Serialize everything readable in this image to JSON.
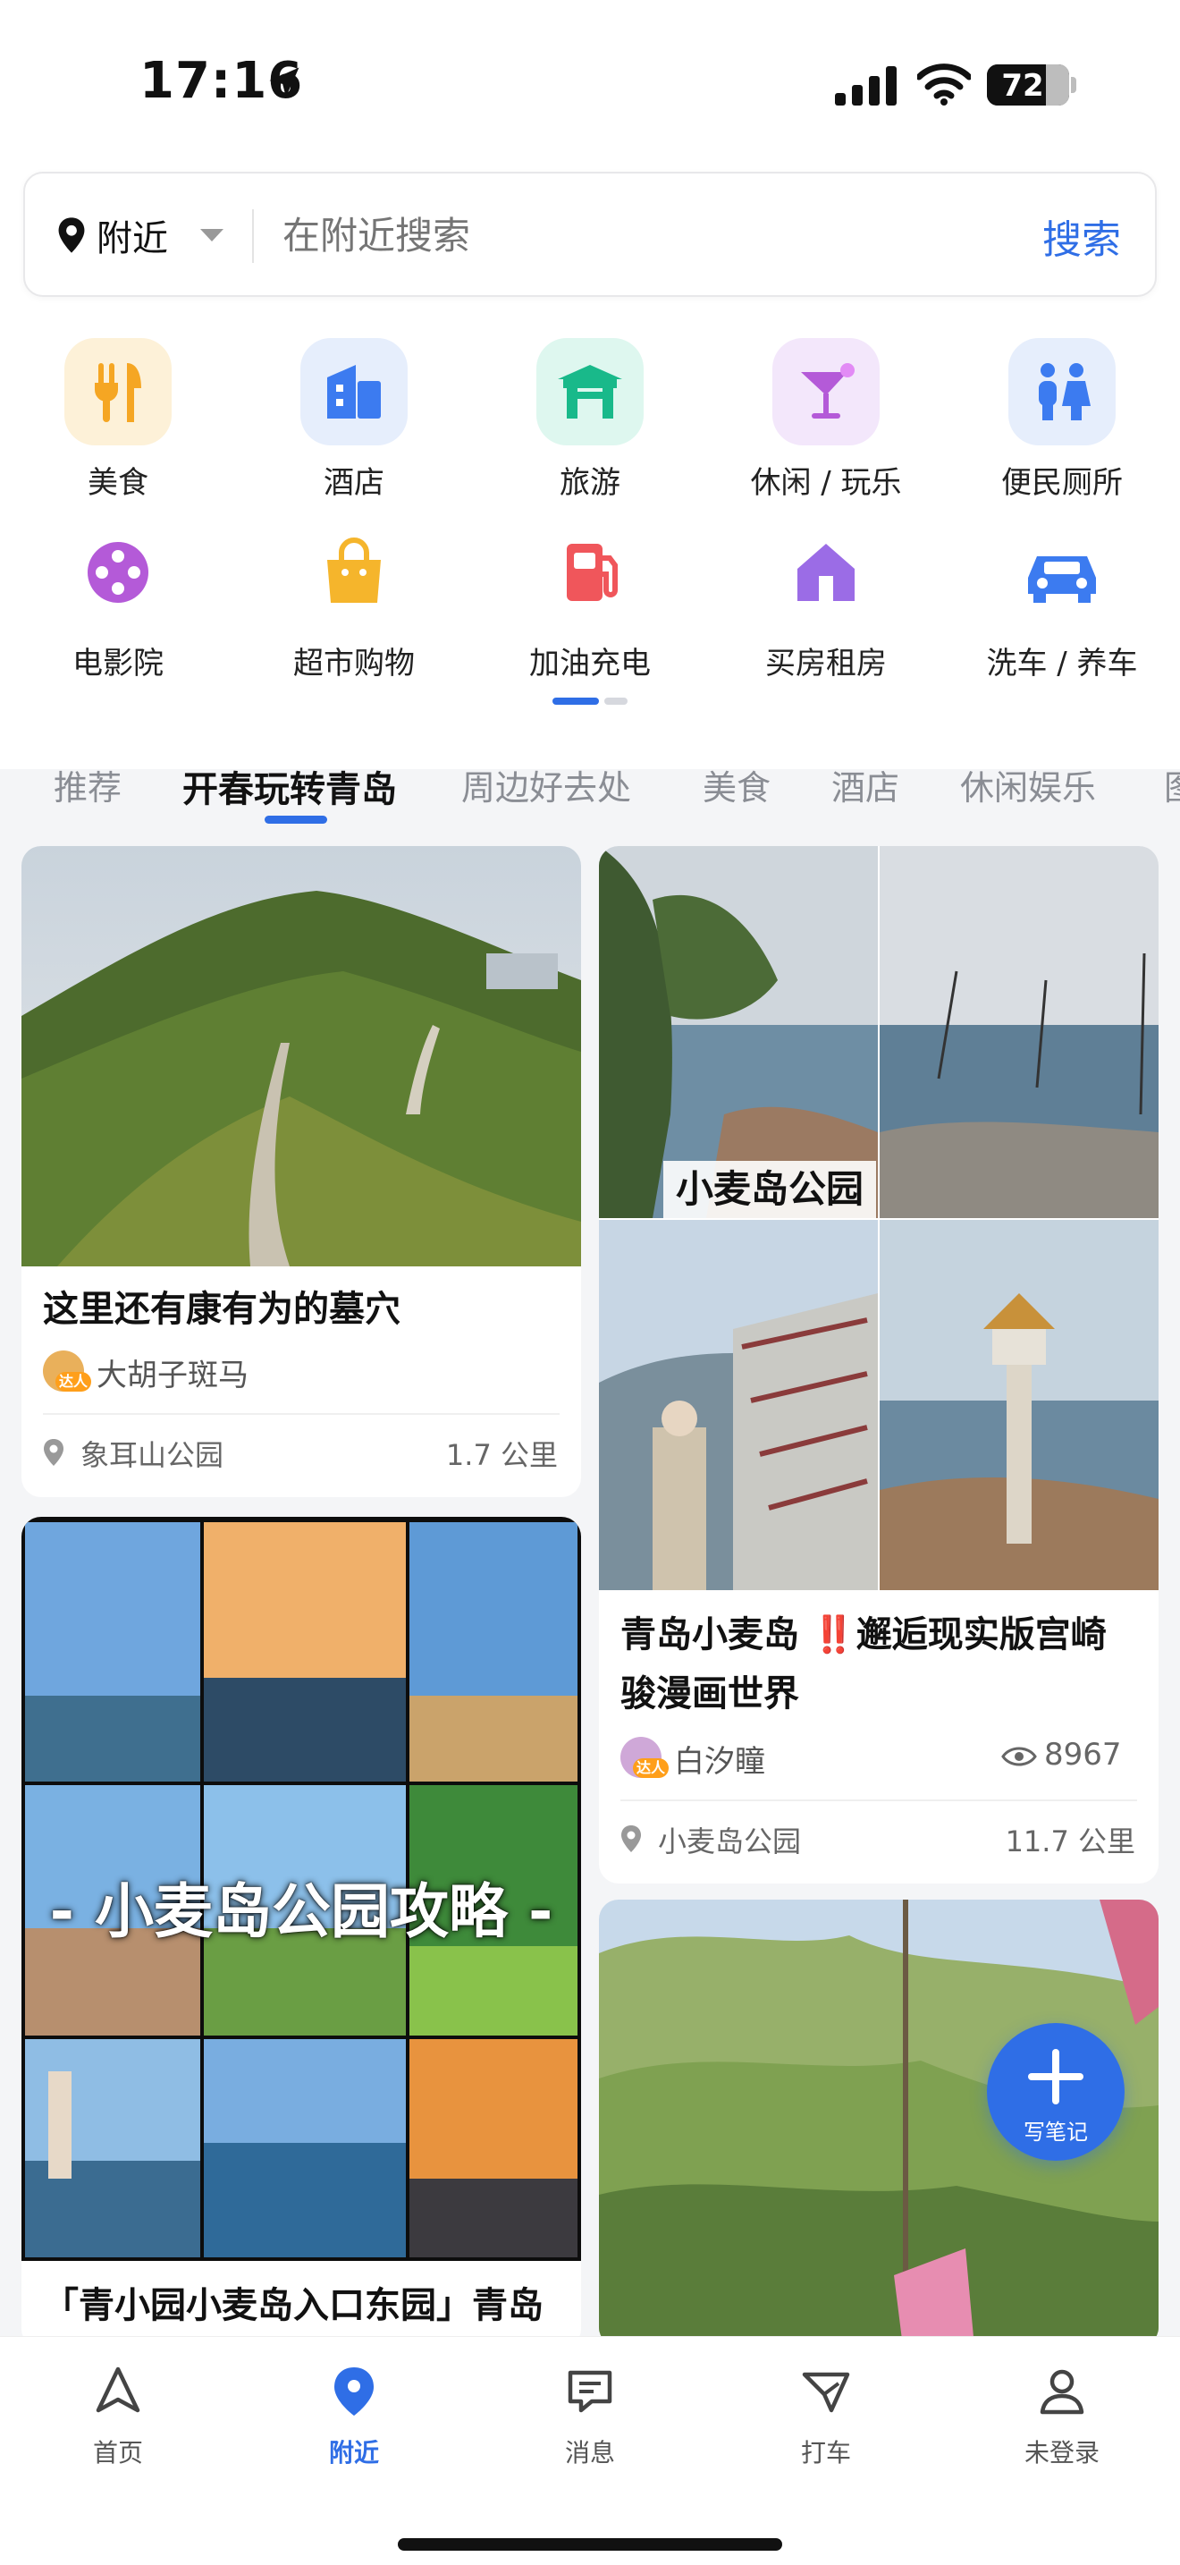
{
  "status": {
    "time": "17:16",
    "battery": "72"
  },
  "search": {
    "location": "附近",
    "placeholder": "在附近搜索",
    "button": "搜索"
  },
  "categories_row1": [
    {
      "label": "美食",
      "icon": "fork-knife-icon"
    },
    {
      "label": "酒店",
      "icon": "hotel-icon"
    },
    {
      "label": "旅游",
      "icon": "gate-icon"
    },
    {
      "label": "休闲 / 玩乐",
      "icon": "cocktail-icon"
    },
    {
      "label": "便民厕所",
      "icon": "restroom-icon"
    }
  ],
  "categories_row2": [
    {
      "label": "电影院",
      "icon": "film-reel-icon"
    },
    {
      "label": "超市购物",
      "icon": "shopping-bag-icon"
    },
    {
      "label": "加油充电",
      "icon": "fuel-pump-icon"
    },
    {
      "label": "买房租房",
      "icon": "house-icon"
    },
    {
      "label": "洗车 / 养车",
      "icon": "car-icon"
    }
  ],
  "tabs": [
    "推荐",
    "开春玩转青岛",
    "周边好去处",
    "美食",
    "酒店",
    "休闲娱乐",
    "图"
  ],
  "cards": {
    "c1": {
      "title": "这里还有康有为的墓穴",
      "author": "大胡子斑马",
      "badge": "达人",
      "place": "象耳山公园",
      "distance": "1.7 公里"
    },
    "c2": {
      "overlay": "小麦岛公园",
      "title_line1": "青岛小麦岛 ‼️邂逅现实版宫崎",
      "title_line2": "骏漫画世界",
      "author": "白汐瞳",
      "badge": "达人",
      "views": "8967",
      "place": "小麦岛公园",
      "distance": "11.7 公里"
    },
    "c3": {
      "overlay": "- 小麦岛公园攻略 -",
      "title_line1": "「青小园小麦岛入口东园」青岛"
    }
  },
  "fab": {
    "label": "写笔记"
  },
  "nav": [
    {
      "label": "首页",
      "icon": "navigation-arrow-icon"
    },
    {
      "label": "附近",
      "icon": "location-pin-icon"
    },
    {
      "label": "消息",
      "icon": "message-icon"
    },
    {
      "label": "打车",
      "icon": "taxi-icon"
    },
    {
      "label": "未登录",
      "icon": "user-icon"
    }
  ],
  "colors": {
    "accent": "#2f6ee6",
    "background": "#f4f5f7"
  }
}
